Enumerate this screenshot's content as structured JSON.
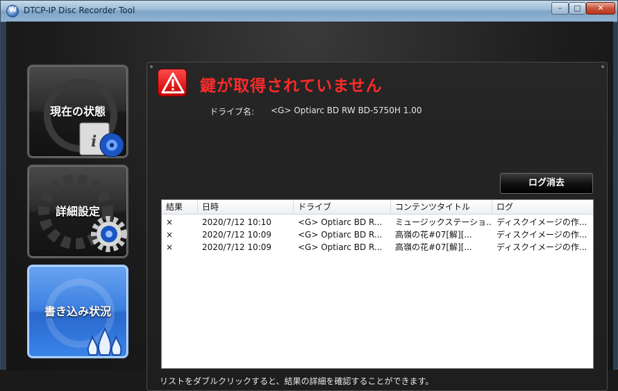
{
  "window": {
    "title": "DTCP-IP Disc Recorder Tool",
    "icon_letter": "W",
    "controls": {
      "minimize": "–",
      "maximize": "□",
      "close": "✕"
    }
  },
  "nav": {
    "items": [
      {
        "label": "現在の状態",
        "icon": "info-disc-icon",
        "active": false
      },
      {
        "label": "詳細設定",
        "icon": "gear-icon",
        "active": false
      },
      {
        "label": "書き込み状況",
        "icon": "flame-icon",
        "active": true
      }
    ]
  },
  "status": {
    "warning_icon": "warning-icon",
    "message": "鍵が取得されていません",
    "drive_label": "ドライブ名:",
    "drive_value": "<G> Optiarc BD RW BD-5750H 1.00"
  },
  "log": {
    "clear_button": "ログ消去",
    "columns": [
      "結果",
      "日時",
      "ドライブ",
      "コンテンツタイトル",
      "ログ"
    ],
    "rows": [
      {
        "result": "×",
        "datetime": "2020/7/12 10:10",
        "drive": "<G> Optiarc BD R...",
        "title": "ミュージックステーショ...",
        "log": "ディスクイメージの作..."
      },
      {
        "result": "×",
        "datetime": "2020/7/12 10:09",
        "drive": "<G> Optiarc BD R...",
        "title": "高嶺の花#07[解][...",
        "log": "ディスクイメージの作..."
      },
      {
        "result": "×",
        "datetime": "2020/7/12 10:09",
        "drive": "<G> Optiarc BD R...",
        "title": "高嶺の花#07[解][...",
        "log": "ディスクイメージの作..."
      }
    ],
    "hint": "リストをダブルクリックすると、結果の詳細を確認することができます。"
  },
  "colors": {
    "warning": "#ff2a2a",
    "active_nav": "#3b7fe0",
    "panel": "#262626"
  }
}
